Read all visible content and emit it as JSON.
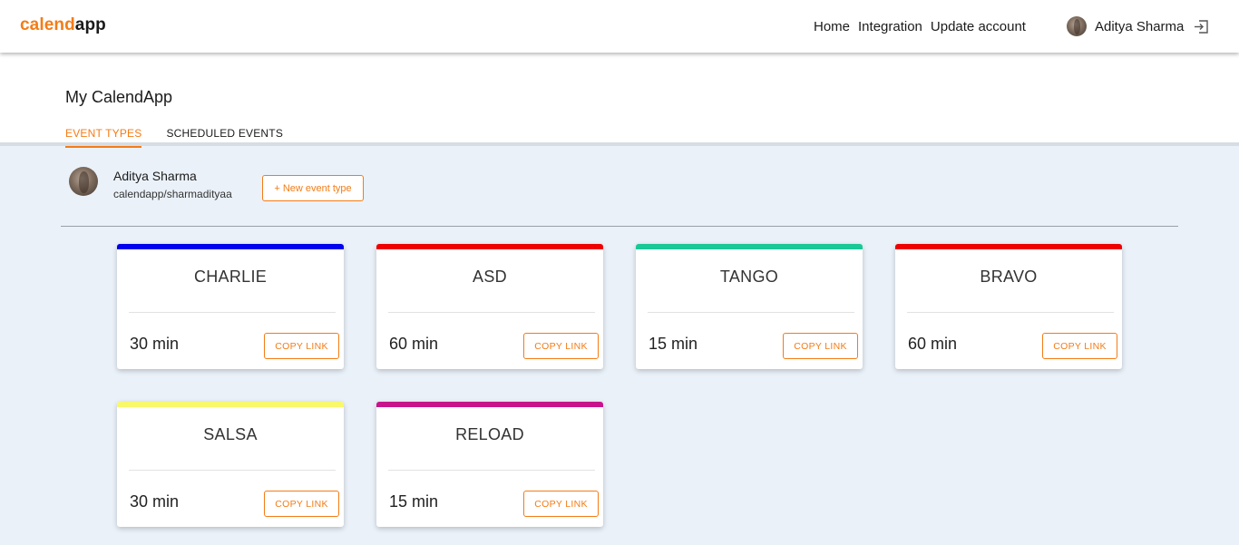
{
  "app": {
    "logo_part1": "calend",
    "logo_part2": "app",
    "brand_color": "#f47c16"
  },
  "nav": {
    "links": [
      "Home",
      "Integration",
      "Update account"
    ],
    "user_name": "Aditya Sharma",
    "logout_icon": "logout-icon"
  },
  "header": {
    "title": "My CalendApp",
    "tabs": [
      {
        "label": "EVENT TYPES",
        "active": true
      },
      {
        "label": "SCHEDULED EVENTS",
        "active": false
      }
    ]
  },
  "profile": {
    "name": "Aditya Sharma",
    "link": "calendapp/sharmadityaa",
    "new_event_label": "+ New event type"
  },
  "cards": [
    {
      "title": "CHARLIE",
      "duration": "30 min",
      "color": "#0000ee",
      "button": "COPY LINK"
    },
    {
      "title": "ASD",
      "duration": "60 min",
      "color": "#ee0000",
      "button": "COPY LINK"
    },
    {
      "title": "TANGO",
      "duration": "15 min",
      "color": "#19c896",
      "button": "COPY LINK"
    },
    {
      "title": "BRAVO",
      "duration": "60 min",
      "color": "#ee0000",
      "button": "COPY LINK"
    },
    {
      "title": "SALSA",
      "duration": "30 min",
      "color": "#f8f86a",
      "button": "COPY LINK"
    },
    {
      "title": "RELOAD",
      "duration": "15 min",
      "color": "#c8148c",
      "button": "COPY LINK"
    }
  ]
}
